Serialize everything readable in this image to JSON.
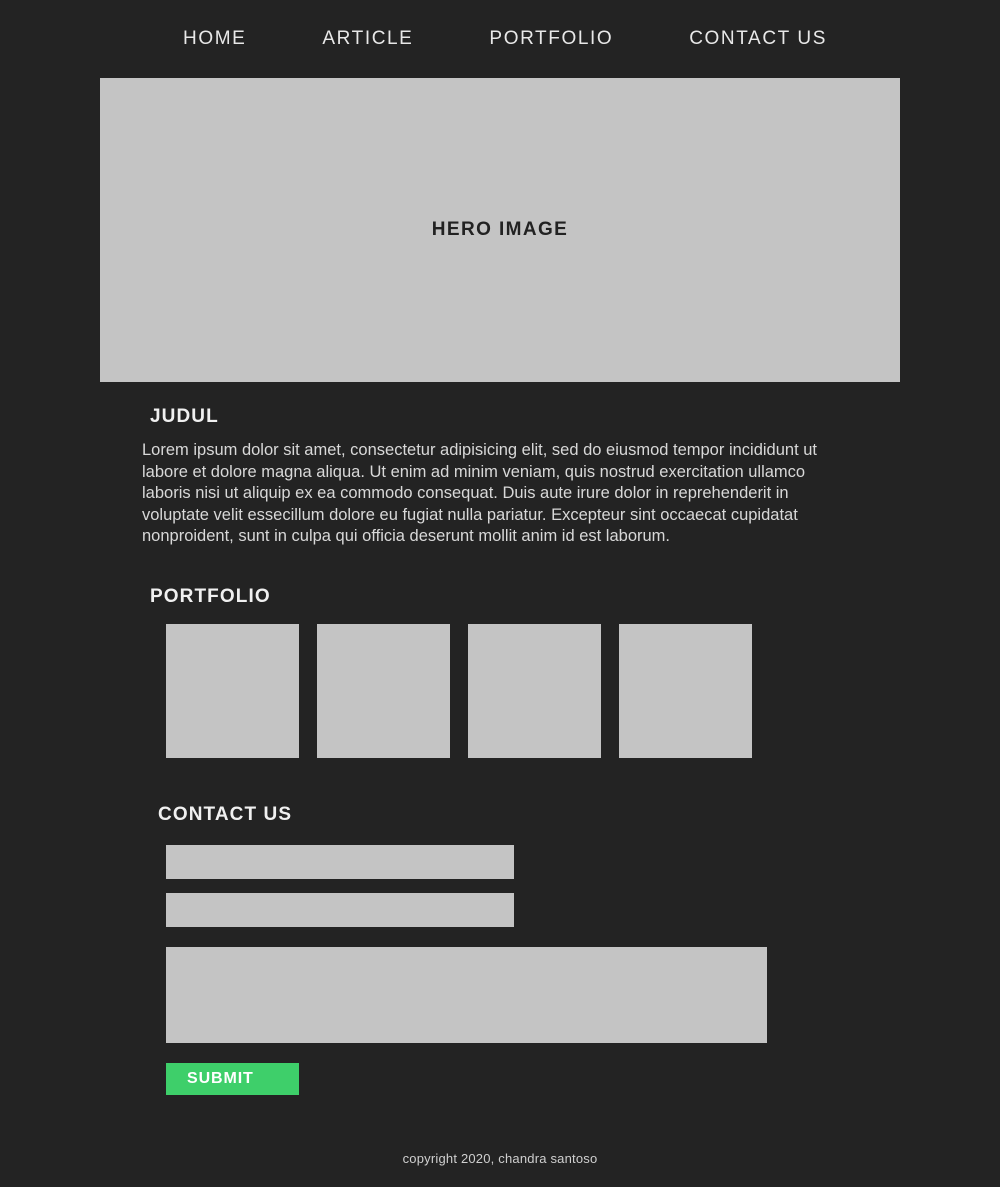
{
  "colors": {
    "background": "#232323",
    "placeholder_gray": "#c4c4c4",
    "accent_green": "#3ecf6a",
    "text_light": "#e8e8e8",
    "text_dark": "#222222"
  },
  "nav": {
    "items": [
      {
        "label": "HOME"
      },
      {
        "label": "ARTICLE"
      },
      {
        "label": "PORTFOLIO"
      },
      {
        "label": "CONTACT US"
      }
    ]
  },
  "hero": {
    "label": "HERO IMAGE"
  },
  "article": {
    "title": "JUDUL",
    "body": "Lorem ipsum dolor sit amet, consectetur adipisicing elit, sed do eiusmod tempor incididunt ut labore et dolore magna aliqua. Ut enim ad minim veniam, quis nostrud exercitation ullamco laboris nisi ut aliquip ex ea commodo consequat. Duis aute irure dolor in reprehenderit in voluptate velit essecillum dolore eu fugiat nulla pariatur. Excepteur sint occaecat cupidatat nonproident, sunt in culpa qui officia deserunt mollit anim id est laborum."
  },
  "portfolio": {
    "title": "PORTFOLIO",
    "items": [
      {
        "label": ""
      },
      {
        "label": ""
      },
      {
        "label": ""
      },
      {
        "label": ""
      }
    ]
  },
  "contact": {
    "title": "CONTACT US",
    "name_field": {
      "value": "",
      "placeholder": ""
    },
    "email_field": {
      "value": "",
      "placeholder": ""
    },
    "message_field": {
      "value": "",
      "placeholder": ""
    },
    "submit_label": "SUBMIT"
  },
  "footer": {
    "copyright": "copyright 2020, chandra santoso"
  }
}
